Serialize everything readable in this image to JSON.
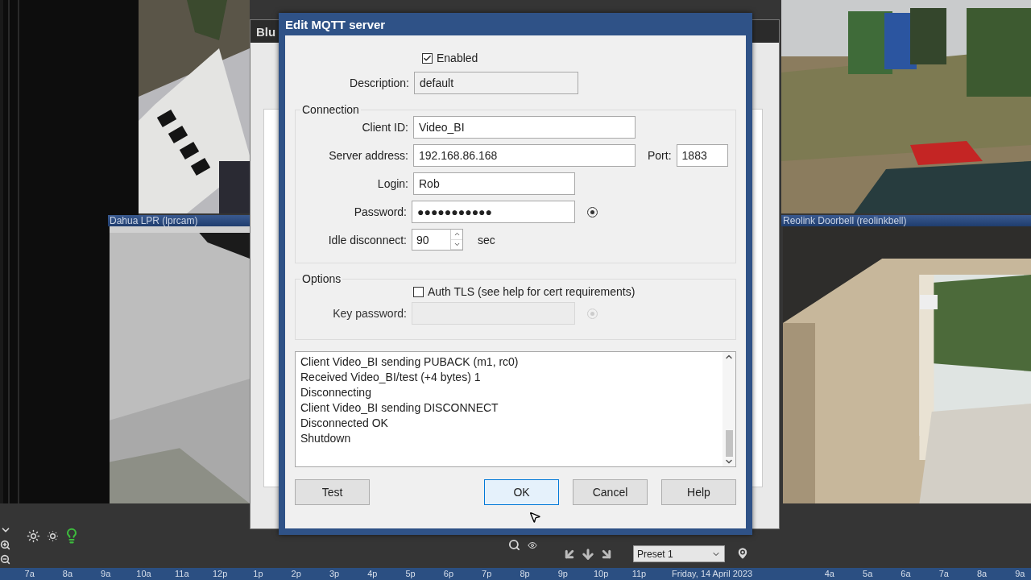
{
  "back_window": {
    "title": "Blu"
  },
  "cameras": [
    {
      "title": "Dahua LPR (lprcam)"
    },
    {
      "title": "Reolink Doorbell (reolinkbell)"
    }
  ],
  "dialog": {
    "title": "Edit MQTT server",
    "enabled": {
      "label": "Enabled",
      "checked": true
    },
    "description": {
      "label": "Description:",
      "value": "default"
    },
    "connection": {
      "title": "Connection",
      "client_id": {
        "label": "Client ID:",
        "value": "Video_BI"
      },
      "server_address": {
        "label": "Server address:",
        "value": "192.168.86.168"
      },
      "port": {
        "label": "Port:",
        "value": "1883"
      },
      "login": {
        "label": "Login:",
        "value": "Rob"
      },
      "password": {
        "label": "Password:",
        "value": "●●●●●●●●●●●"
      },
      "idle_disconnect": {
        "label": "Idle disconnect:",
        "value": "90",
        "unit": "sec"
      }
    },
    "options": {
      "title": "Options",
      "auth_tls": {
        "label": "Auth TLS (see help for cert requirements)",
        "checked": false
      },
      "key_password": {
        "label": "Key password:",
        "disabled": true
      }
    },
    "log": [
      "Client Video_BI sending PUBACK (m1, rc0)",
      "Received Video_BI/test (+4 bytes) 1",
      "Disconnecting",
      "Client Video_BI sending DISCONNECT",
      "Disconnected OK",
      "Shutdown"
    ],
    "buttons": [
      {
        "label": "Test",
        "focused": false
      },
      {
        "label": "OK",
        "focused": true
      },
      {
        "label": "Cancel",
        "focused": false
      },
      {
        "label": "Help",
        "focused": false
      }
    ]
  },
  "ptz": {
    "preset": "Preset 1"
  },
  "timeline": {
    "hours_before": [
      "7a",
      "8a",
      "9a",
      "10a",
      "11a",
      "12p",
      "1p",
      "2p",
      "3p",
      "4p",
      "5p",
      "6p",
      "7p",
      "8p",
      "9p",
      "10p",
      "11p"
    ],
    "date": "Friday, 14 April 2023",
    "hours_after": [
      "4a",
      "5a",
      "6a",
      "7a",
      "8a",
      "9a"
    ]
  }
}
